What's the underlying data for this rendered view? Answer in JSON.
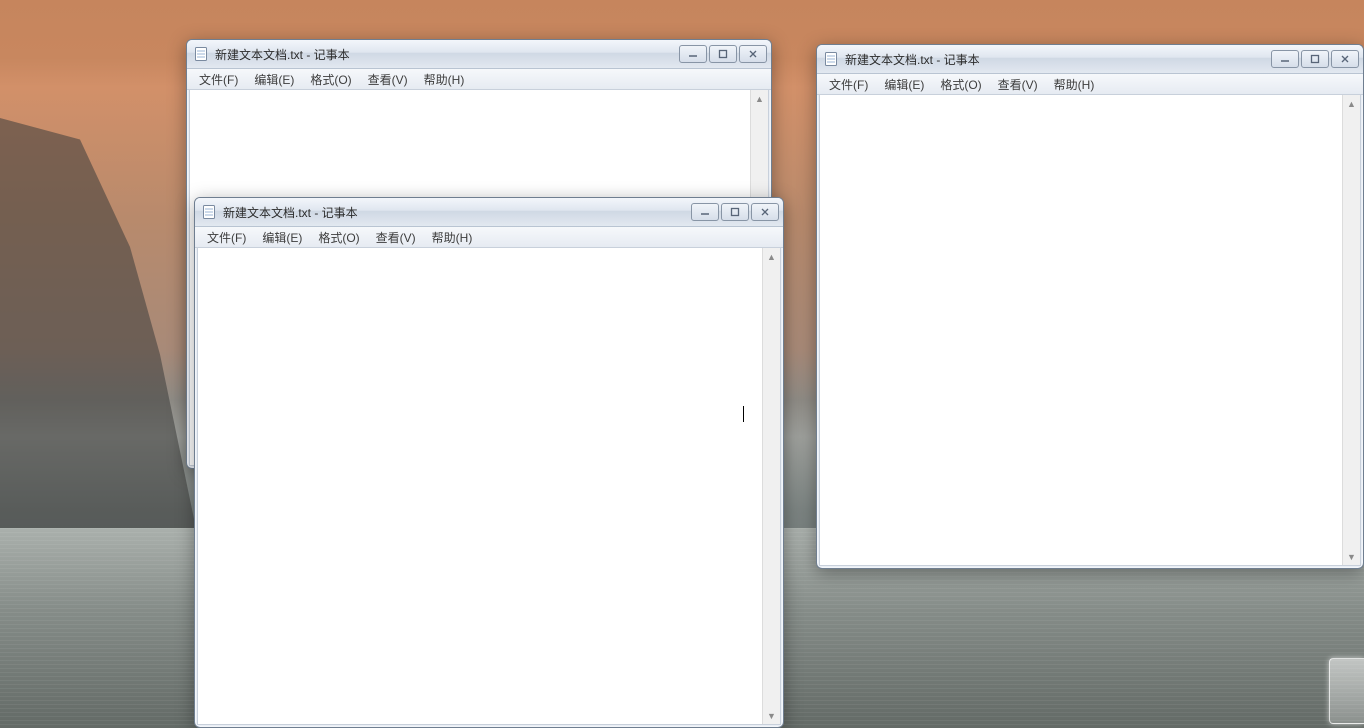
{
  "windows": {
    "back_left": {
      "title": "新建文本文档.txt - 记事本"
    },
    "front_middle": {
      "title": "新建文本文档.txt - 记事本"
    },
    "right": {
      "title": "新建文本文档.txt - 记事本"
    }
  },
  "menu": {
    "file": "文件(F)",
    "edit": "编辑(E)",
    "format": "格式(O)",
    "view": "查看(V)",
    "help": "帮助(H)"
  },
  "window_controls": {
    "minimize": "minimize",
    "maximize": "maximize",
    "close": "close"
  }
}
